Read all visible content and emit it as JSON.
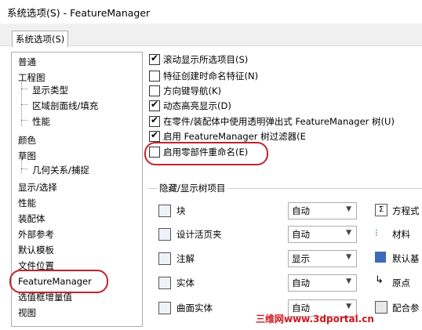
{
  "window": {
    "title": "系统选项(S) - FeatureManager"
  },
  "tabs": [
    {
      "label": "系统选项(S)"
    }
  ],
  "tree": {
    "items": [
      {
        "label": "普通"
      },
      {
        "label": "工程图"
      },
      {
        "label": "显示类型"
      },
      {
        "label": "区域剖面线/填充"
      },
      {
        "label": "性能"
      },
      {
        "label": "颜色"
      },
      {
        "label": "草图"
      },
      {
        "label": "几何关系/捕捉"
      },
      {
        "label": "显示/选择"
      },
      {
        "label": "性能"
      },
      {
        "label": "装配体"
      },
      {
        "label": "外部参考"
      },
      {
        "label": "默认模板"
      },
      {
        "label": "文件位置"
      },
      {
        "label": "FeatureManager"
      },
      {
        "label": "选值框增量值"
      },
      {
        "label": "视图"
      }
    ],
    "selected": "FeatureManager"
  },
  "options": [
    {
      "label": "滚动显示所选项目(S)",
      "checked": true
    },
    {
      "label": "特征创建时命名特征(N)",
      "checked": false
    },
    {
      "label": "方向键导航(K)",
      "checked": false
    },
    {
      "label": "动态高亮显示(D)",
      "checked": true
    },
    {
      "label": "在零件/装配体中使用透明弹出式 FeatureManager 树(U)",
      "checked": true
    },
    {
      "label": "启用 FeatureManager 树过滤器(E",
      "checked": true
    },
    {
      "label": "启用零部件重命名(E)",
      "checked": false
    }
  ],
  "group": {
    "title": "隐藏/显示树项目",
    "rows": [
      {
        "label": "块",
        "icon": "block-icon",
        "value": "自动"
      },
      {
        "label": "设计活页夹",
        "icon": "design-binder-icon",
        "value": "自动"
      },
      {
        "label": "注解",
        "icon": "annotation-icon",
        "value": "显示"
      },
      {
        "label": "实体",
        "icon": "solid-body-icon",
        "value": "自动"
      },
      {
        "label": "曲面实体",
        "icon": "surface-body-icon",
        "value": "自动"
      }
    ],
    "right_items": [
      {
        "label": "方程式",
        "icon": "equation-icon"
      },
      {
        "label": "材料",
        "icon": "material-icon"
      },
      {
        "label": "默认基",
        "icon": "default-plane-icon"
      },
      {
        "label": "原点",
        "icon": "origin-icon"
      },
      {
        "label": "配合参",
        "icon": "mate-reference-icon"
      }
    ]
  },
  "watermark": "三维网www.3dportal.cn",
  "colors": {
    "annotation": "#c0262c",
    "watermark": "#d4141b"
  }
}
